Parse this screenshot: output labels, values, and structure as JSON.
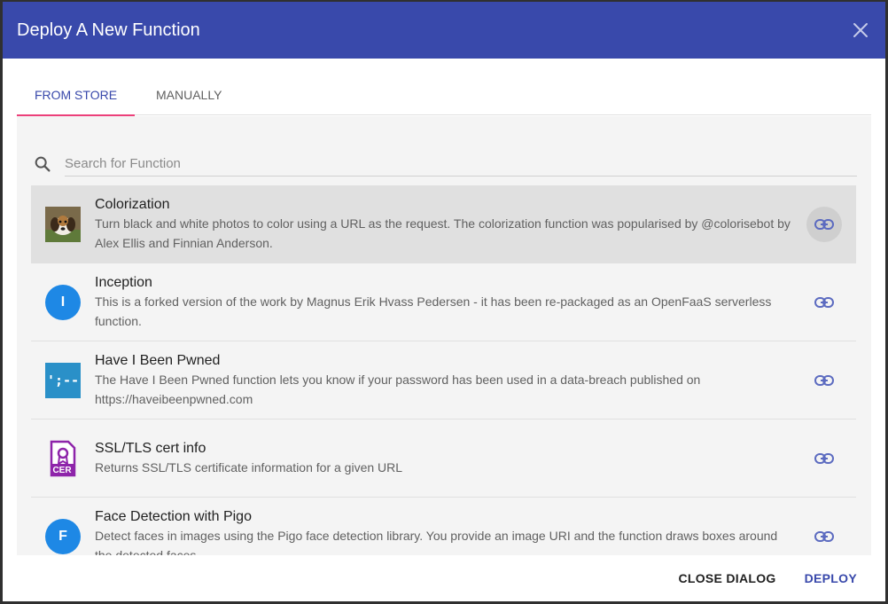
{
  "dialog": {
    "title": "Deploy A New Function"
  },
  "tabs": [
    {
      "label": "FROM STORE",
      "active": true
    },
    {
      "label": "MANUALLY",
      "active": false
    }
  ],
  "search": {
    "placeholder": "Search for Function",
    "value": ""
  },
  "functions": [
    {
      "title": "Colorization",
      "description": "Turn black and white photos to color using a URL as the request. The colorization function was popularised by @colorisebot by Alex Ellis and Finnian Anderson.",
      "icon": "dog-photo-icon",
      "selected": true
    },
    {
      "title": "Inception",
      "description": "This is a forked version of the work by Magnus Erik Hvass Pedersen - it has been re-packaged as an OpenFaaS serverless function.",
      "icon": "letter-avatar-icon",
      "avatar_letter": "I"
    },
    {
      "title": "Have I Been Pwned",
      "description": "The Have I Been Pwned function lets you know if your password has been used in a data-breach published on https://haveibeenpwned.com",
      "icon": "hibp-logo-icon",
      "avatar_text": "';--"
    },
    {
      "title": "SSL/TLS cert info",
      "description": "Returns SSL/TLS certificate information for a given URL",
      "icon": "certificate-icon",
      "badge_text": "CER"
    },
    {
      "title": "Face Detection with Pigo",
      "description": "Detect faces in images using the Pigo face detection library. You provide an image URI and the function draws boxes around the detected faces.",
      "icon": "letter-avatar-icon",
      "avatar_letter": "F"
    }
  ],
  "actions": {
    "close_label": "CLOSE DIALOG",
    "deploy_label": "DEPLOY"
  },
  "colors": {
    "header": "#3949ab",
    "tab_indicator": "#ec407a",
    "avatar_blue": "#1e88e5",
    "certificate_purple": "#8e24aa"
  }
}
